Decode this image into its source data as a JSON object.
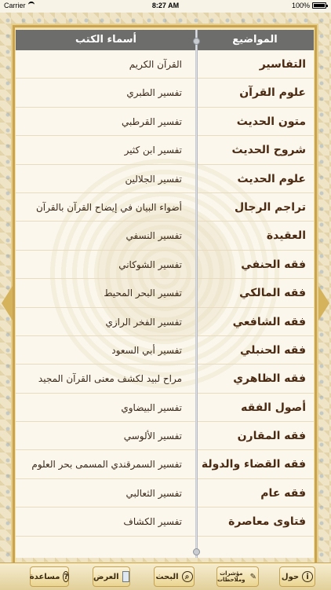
{
  "status": {
    "carrier": "Carrier",
    "time": "8:27 AM",
    "battery": "100%"
  },
  "header": {
    "topics_title": "المواضيع",
    "books_title": "أسماء الكتب"
  },
  "rows": [
    {
      "topic": "التفاسير",
      "book": "القرآن الكريم"
    },
    {
      "topic": "علوم القرآن",
      "book": "تفسير الطبري"
    },
    {
      "topic": "متون الحديث",
      "book": "تفسير القرطبي"
    },
    {
      "topic": "شروح الحديث",
      "book": "تفسير ابن كثير"
    },
    {
      "topic": "علوم الحديث",
      "book": "تفسير الجلالين"
    },
    {
      "topic": "تراجم الرجال",
      "book": "أضواء البيان في إيضاح القرآن بالقرآن"
    },
    {
      "topic": "العقيدة",
      "book": "تفسير النسفي"
    },
    {
      "topic": "فقه الحنفي",
      "book": "تفسير الشوكاني"
    },
    {
      "topic": "فقه المالكي",
      "book": "تفسير البحر المحيط"
    },
    {
      "topic": "فقه الشافعي",
      "book": "تفسير الفخر الرازي"
    },
    {
      "topic": "فقه الحنبلي",
      "book": "تفسير أبي السعود"
    },
    {
      "topic": "فقه الظاهري",
      "book": "مراح لبيد لكشف معنى القرآن المجيد"
    },
    {
      "topic": "أصول الفقه",
      "book": "تفسير البيضاوي"
    },
    {
      "topic": "فقه المقارن",
      "book": "تفسير الألوسي"
    },
    {
      "topic": "فقه القضاء والدولة",
      "book": "تفسير السمرقندي المسمى بحر العلوم"
    },
    {
      "topic": "فقه عام",
      "book": "تفسير الثعالبي"
    },
    {
      "topic": "فتاوى معاصرة",
      "book": "تفسير الكشاف"
    }
  ],
  "toolbar": {
    "help_label": "مساعدة",
    "view_label": "العرض",
    "search_label": "البحث",
    "notes_label_1": "مؤشرات",
    "notes_label_2": "وملاحظات",
    "about_label": "حول"
  },
  "colors": {
    "header_bg": "#6d6d6b",
    "topic_text": "#4a2a12",
    "gold_accent": "#c9a34f"
  }
}
